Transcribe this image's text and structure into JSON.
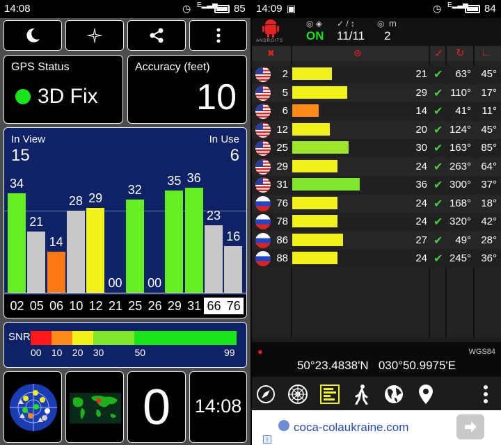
{
  "left": {
    "status_bar": {
      "time": "14:08",
      "battery": "85",
      "signal_label": "E"
    },
    "gps_status": {
      "title": "GPS Status",
      "value": "3D Fix"
    },
    "accuracy": {
      "title": "Accuracy (feet)",
      "value": "10"
    },
    "in_view": {
      "label": "In View",
      "value": "15"
    },
    "in_use": {
      "label": "In Use",
      "value": "6"
    },
    "bars": [
      {
        "id": "02",
        "value": 34,
        "label": "34",
        "color": "#66ee22",
        "selected": false
      },
      {
        "id": "05",
        "value": 21,
        "label": "21",
        "color": "#c8c8c8",
        "selected": false
      },
      {
        "id": "06",
        "value": 14,
        "label": "14",
        "color": "#ff7a12",
        "selected": false
      },
      {
        "id": "10",
        "value": 28,
        "label": "28",
        "color": "#c8c8c8",
        "selected": false
      },
      {
        "id": "12",
        "value": 29,
        "label": "29",
        "color": "#f2f21a",
        "selected": false
      },
      {
        "id": "21",
        "value": 0,
        "label": "00",
        "color": "#c8c8c8",
        "selected": false
      },
      {
        "id": "25",
        "value": 32,
        "label": "32",
        "color": "#66ee22",
        "selected": false
      },
      {
        "id": "26",
        "value": 0,
        "label": "00",
        "color": "#c8c8c8",
        "selected": false
      },
      {
        "id": "29",
        "value": 35,
        "label": "35",
        "color": "#66ee22",
        "selected": false
      },
      {
        "id": "31",
        "value": 36,
        "label": "36",
        "color": "#66ee22",
        "selected": false
      },
      {
        "id": "66",
        "value": 23,
        "label": "23",
        "color": "#c8c8c8",
        "selected": true
      },
      {
        "id": "76",
        "value": 16,
        "label": "16",
        "color": "#c8c8c8",
        "selected": true
      }
    ],
    "snr": {
      "label": "SNR",
      "segments": [
        {
          "from": 0,
          "to": 10,
          "color": "#ff1a1a"
        },
        {
          "from": 10,
          "to": 20,
          "color": "#ff8a1a"
        },
        {
          "from": 20,
          "to": 30,
          "color": "#f2f21a"
        },
        {
          "from": 30,
          "to": 50,
          "color": "#7fe62a"
        },
        {
          "from": 50,
          "to": 99,
          "color": "#19e619"
        }
      ],
      "ticks": [
        "00",
        "10",
        "20",
        "30",
        "50",
        "99"
      ]
    },
    "clock_tile": "14:08",
    "speed_tile": "0"
  },
  "right": {
    "status_bar": {
      "time": "14:09",
      "battery": "84",
      "signal_label": "E"
    },
    "header": {
      "status": "ON",
      "sats": "11/11",
      "accuracy": "2",
      "unit": "m",
      "logo_text": "ANDROITS"
    },
    "rows": [
      {
        "prn": "2",
        "country": "us",
        "snr": 21,
        "bar_color": "#f2f21a",
        "used": true,
        "azimuth": "63°",
        "elevation": "45°"
      },
      {
        "prn": "5",
        "country": "us",
        "snr": 29,
        "bar_color": "#f2f21a",
        "used": true,
        "azimuth": "110°",
        "elevation": "17°"
      },
      {
        "prn": "6",
        "country": "us",
        "snr": 14,
        "bar_color": "#ff8a1a",
        "used": true,
        "azimuth": "41°",
        "elevation": "11°"
      },
      {
        "prn": "12",
        "country": "us",
        "snr": 20,
        "bar_color": "#f2f21a",
        "used": true,
        "azimuth": "124°",
        "elevation": "45°"
      },
      {
        "prn": "25",
        "country": "us",
        "snr": 30,
        "bar_color": "#9ee62a",
        "used": true,
        "azimuth": "163°",
        "elevation": "85°"
      },
      {
        "prn": "29",
        "country": "us",
        "snr": 24,
        "bar_color": "#f2f21a",
        "used": true,
        "azimuth": "263°",
        "elevation": "64°"
      },
      {
        "prn": "31",
        "country": "us",
        "snr": 36,
        "bar_color": "#7fe62a",
        "used": true,
        "azimuth": "300°",
        "elevation": "37°"
      },
      {
        "prn": "76",
        "country": "ru",
        "snr": 24,
        "bar_color": "#f2f21a",
        "used": true,
        "azimuth": "168°",
        "elevation": "18°"
      },
      {
        "prn": "78",
        "country": "ru",
        "snr": 24,
        "bar_color": "#f2f21a",
        "used": true,
        "azimuth": "320°",
        "elevation": "42°"
      },
      {
        "prn": "86",
        "country": "ru",
        "snr": 27,
        "bar_color": "#f2f21a",
        "used": true,
        "azimuth": "49°",
        "elevation": "28°"
      },
      {
        "prn": "88",
        "country": "ru",
        "snr": 24,
        "bar_color": "#f2f21a",
        "used": true,
        "azimuth": "245°",
        "elevation": "36°"
      }
    ],
    "datum": "WGS84",
    "coordinates": "50°23.4838'N   030°50.9975'E",
    "ad": {
      "text": "coca-colaukraine.com"
    }
  }
}
